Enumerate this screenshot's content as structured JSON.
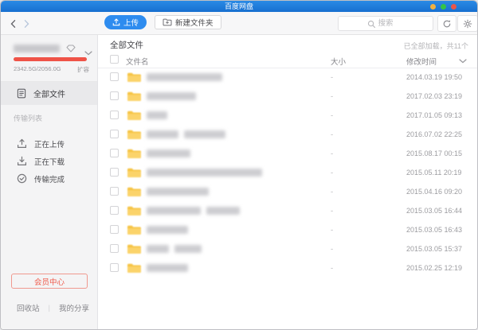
{
  "window": {
    "title": "百度网盘"
  },
  "traffic_lights": {
    "colors": [
      "#f0b141",
      "#35c347",
      "#e8564a"
    ]
  },
  "colors": {
    "accent": "#2e8cef",
    "danger": "#ef5348",
    "titlebar_top": "#2a8ae5",
    "titlebar_bottom": "#176fd0",
    "folder_light": "#fbd36a",
    "folder_dark": "#f6c444"
  },
  "toolbar": {
    "upload_label": "上传",
    "new_folder_label": "新建文件夹",
    "search_placeholder": "搜索"
  },
  "sidebar": {
    "quota_text": "2342.5G/2056.0G",
    "expand_label": "扩容",
    "all_files_label": "全部文件",
    "transfer_section_label": "传输列表",
    "transfer_items": [
      {
        "label": "正在上传",
        "icon": "upload-tray-icon"
      },
      {
        "label": "正在下载",
        "icon": "download-tray-icon"
      },
      {
        "label": "传输完成",
        "icon": "check-circle-icon"
      }
    ],
    "member_center_label": "会员中心",
    "recycle_label": "回收站",
    "footer_divider": "|",
    "my_share_label": "我的分享"
  },
  "main": {
    "breadcrumb": "全部文件",
    "load_status": "已全部加载，共11个",
    "columns": {
      "name": "文件名",
      "size": "大小",
      "mtime": "修改时间"
    },
    "rows": [
      {
        "size": "-",
        "mtime": "2014.03.19 19:50",
        "redacted_name_widths": [
          95
        ]
      },
      {
        "size": "-",
        "mtime": "2017.02.03 23:19",
        "redacted_name_widths": [
          62
        ]
      },
      {
        "size": "-",
        "mtime": "2017.01.05 09:13",
        "redacted_name_widths": [
          26
        ]
      },
      {
        "size": "-",
        "mtime": "2016.07.02 22:25",
        "redacted_name_widths": [
          40,
          52
        ]
      },
      {
        "size": "-",
        "mtime": "2015.08.17 00:15",
        "redacted_name_widths": [
          55
        ]
      },
      {
        "size": "-",
        "mtime": "2015.05.11 20:19",
        "redacted_name_widths": [
          145
        ]
      },
      {
        "size": "-",
        "mtime": "2015.04.16 09:20",
        "redacted_name_widths": [
          78
        ]
      },
      {
        "size": "-",
        "mtime": "2015.03.05 16:44",
        "redacted_name_widths": [
          68,
          42
        ]
      },
      {
        "size": "-",
        "mtime": "2015.03.05 16:43",
        "redacted_name_widths": [
          52
        ]
      },
      {
        "size": "-",
        "mtime": "2015.03.05 15:37",
        "redacted_name_widths": [
          28,
          34
        ]
      },
      {
        "size": "-",
        "mtime": "2015.02.25 12:19",
        "redacted_name_widths": [
          52
        ]
      }
    ]
  }
}
